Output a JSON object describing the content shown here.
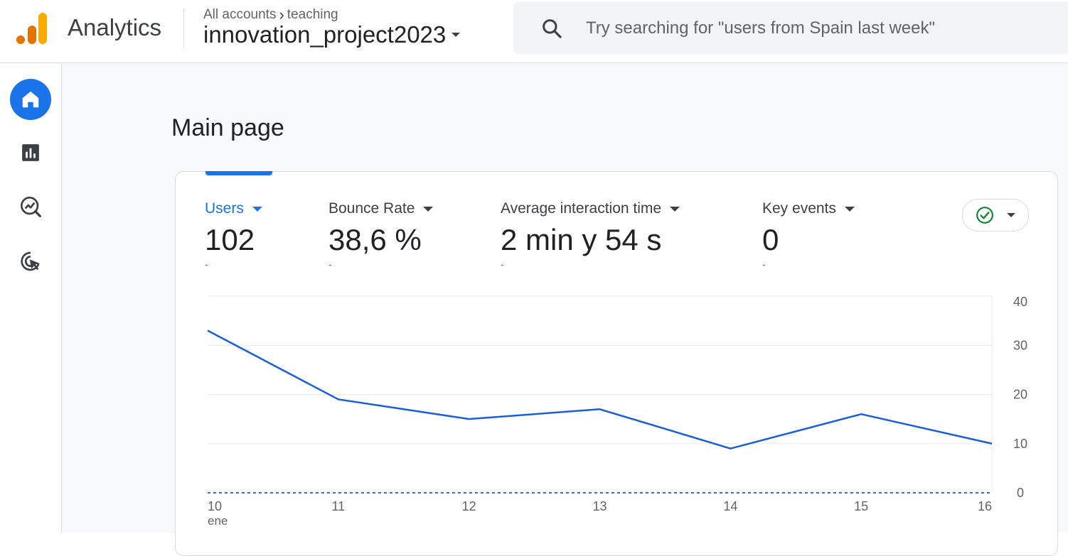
{
  "header": {
    "app_name": "Analytics",
    "breadcrumb": {
      "account": "All accounts",
      "separator": "›",
      "folder": "teaching"
    },
    "property_name": "innovation_project2023",
    "search_placeholder": "Try searching for \"users from Spain last week\""
  },
  "sidebar": {
    "items": [
      {
        "name": "home",
        "icon": "home-icon",
        "active": true
      },
      {
        "name": "reports",
        "icon": "bar-chart-icon",
        "active": false
      },
      {
        "name": "explore",
        "icon": "explore-icon",
        "active": false
      },
      {
        "name": "advertising",
        "icon": "advertising-icon",
        "active": false
      }
    ]
  },
  "main": {
    "title": "Main page",
    "metrics": [
      {
        "label": "Users",
        "value": "102",
        "change": "-",
        "selected": true
      },
      {
        "label": "Bounce Rate",
        "value": "38,6 %",
        "change": "-",
        "selected": false
      },
      {
        "label": "Average interaction time",
        "value": "2 min y 54 s",
        "change": "-",
        "selected": false
      },
      {
        "label": "Key events",
        "value": "0",
        "change": "-",
        "selected": false
      }
    ],
    "status_icon": "check-circle-icon"
  },
  "colors": {
    "accent": "#1a73e8",
    "line": "#1a5fd6",
    "status_green": "#188038"
  },
  "chart_data": {
    "type": "line",
    "x": [
      "10",
      "11",
      "12",
      "13",
      "14",
      "15",
      "16"
    ],
    "x_sublabel_first": "ene",
    "series": [
      {
        "values": [
          33,
          19,
          15,
          17,
          9,
          16,
          10
        ]
      },
      {
        "values": [
          0,
          0,
          0,
          0,
          0,
          0,
          0
        ],
        "style": "dashed"
      }
    ],
    "y_ticks": [
      "40",
      "30",
      "20",
      "10",
      "0"
    ],
    "ylim": [
      0,
      40
    ],
    "y_axis_side": "right",
    "grid": true
  }
}
